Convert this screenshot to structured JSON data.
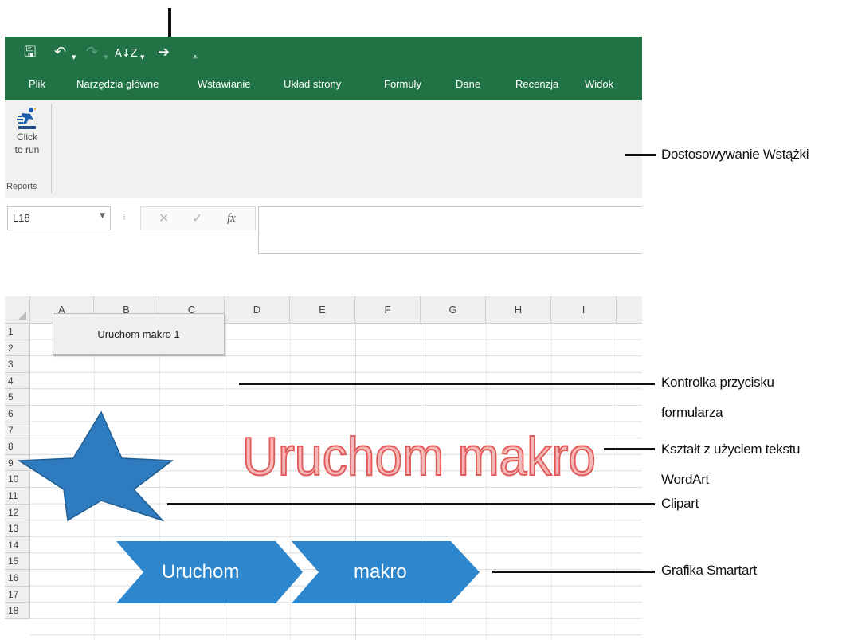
{
  "qat": {
    "save_icon": "save-icon",
    "undo_icon": "undo-icon",
    "redo_icon": "redo-icon",
    "sort_icon": "sort-icon",
    "macro_icon": "run-macro-icon",
    "customize_icon": "customize-qat-icon"
  },
  "menu": [
    "Plik",
    "Narzędzia główne",
    "Wstawianie",
    "Układ strony",
    "Formuły",
    "Dane",
    "Recenzja",
    "Widok"
  ],
  "ribbon": {
    "button_line1": "Click",
    "button_line2": "to run",
    "group": "Reports"
  },
  "formula_bar": {
    "name_box": "L18",
    "cancel": "✕",
    "enter": "✓",
    "fx": "fx",
    "value": ""
  },
  "grid": {
    "columns": [
      "A",
      "B",
      "C",
      "D",
      "E",
      "F",
      "G",
      "H",
      "I"
    ],
    "rows": [
      "1",
      "2",
      "3",
      "4",
      "5",
      "6",
      "7",
      "8",
      "9",
      "10",
      "11",
      "12",
      "13",
      "14",
      "15",
      "16",
      "17",
      "18"
    ]
  },
  "objects": {
    "form_button": "Uruchom makro 1",
    "wordart": "Uruchom makro",
    "smartart_1": "Uruchom",
    "smartart_2": "makro",
    "wordart_color": "#f4a0a0",
    "wordart_stroke": "#e05555",
    "star_color": "#2e7bbf",
    "smartart_color": "#2e86cc"
  },
  "callouts": {
    "ribbon": "Dostosowywanie Wstążki",
    "form_button_1": "Kontrolka przycisku",
    "form_button_2": "formularza",
    "wordart_1": "Kształt z użyciem tekstu",
    "wordart_2": "WordArt",
    "clipart": "Clipart",
    "smartart": "Grafika Smartart"
  },
  "colors": {
    "excel_green": "#217346"
  }
}
